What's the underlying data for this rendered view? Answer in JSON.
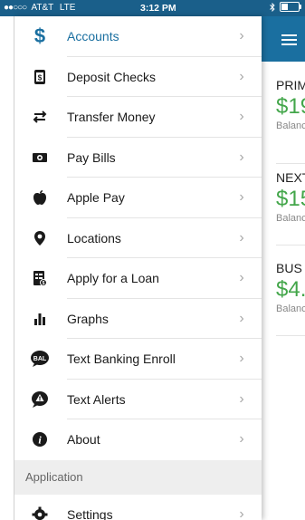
{
  "status_bar": {
    "carrier": "AT&T",
    "network": "LTE",
    "time": "3:12 PM"
  },
  "drawer": {
    "items": [
      {
        "label": "Accounts",
        "icon": "dollar-icon",
        "active": true
      },
      {
        "label": "Deposit Checks",
        "icon": "check-deposit-icon"
      },
      {
        "label": "Transfer Money",
        "icon": "transfer-arrows-icon"
      },
      {
        "label": "Pay Bills",
        "icon": "cash-icon"
      },
      {
        "label": "Apple Pay",
        "icon": "apple-icon"
      },
      {
        "label": "Locations",
        "icon": "location-pin-icon"
      },
      {
        "label": "Apply for a Loan",
        "icon": "loan-application-icon"
      },
      {
        "label": "Graphs",
        "icon": "bar-chart-icon"
      },
      {
        "label": "Text Banking Enroll",
        "icon": "bal-chat-icon"
      },
      {
        "label": "Text Alerts",
        "icon": "alert-chat-icon"
      },
      {
        "label": "About",
        "icon": "info-icon"
      }
    ],
    "section_header": "Application",
    "after_section": [
      {
        "label": "Settings",
        "icon": "gear-icon"
      }
    ]
  },
  "main": {
    "accounts": [
      {
        "name": "PRIM",
        "amount": "$19",
        "balance_label": "Balanc"
      },
      {
        "name": "NEXT",
        "amount": "$15",
        "balance_label": "Balanc"
      },
      {
        "name": "BUS",
        "amount": "$4.",
        "balance_label": "Balanc"
      }
    ]
  },
  "colors": {
    "accent": "#1a6fa0",
    "status_bar": "#1a5f8a",
    "amount_green": "#43a64a"
  }
}
